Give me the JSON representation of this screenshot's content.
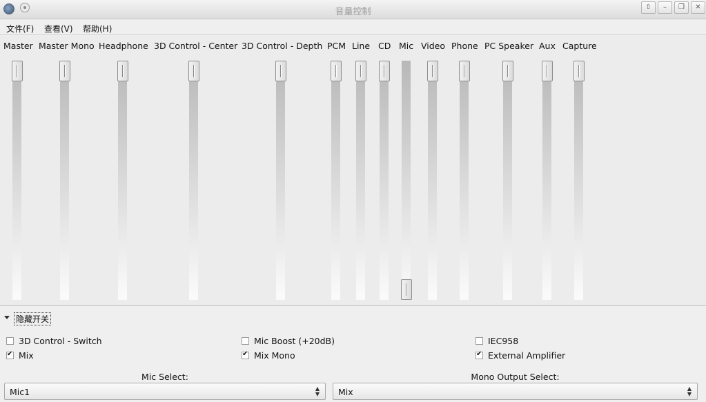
{
  "window": {
    "title": "音量控制",
    "buttons": [
      "⇧",
      "–",
      "❐",
      "✕"
    ]
  },
  "menu": [
    {
      "label": "文件(F)"
    },
    {
      "label": "查看(V)"
    },
    {
      "label": "帮助(H)"
    }
  ],
  "channels": [
    {
      "name": "Master",
      "level": 1.0
    },
    {
      "name": "Master Mono",
      "level": 1.0
    },
    {
      "name": "Headphone",
      "level": 1.0
    },
    {
      "name": "3D Control - Center",
      "level": 1.0
    },
    {
      "name": "3D Control - Depth",
      "level": 1.0
    },
    {
      "name": "PCM",
      "level": 1.0
    },
    {
      "name": "Line",
      "level": 1.0
    },
    {
      "name": "CD",
      "level": 1.0
    },
    {
      "name": "Mic",
      "level": 0.0
    },
    {
      "name": "Video",
      "level": 1.0
    },
    {
      "name": "Phone",
      "level": 1.0
    },
    {
      "name": "PC Speaker",
      "level": 1.0
    },
    {
      "name": "Aux",
      "level": 1.0
    },
    {
      "name": "Capture",
      "level": 1.0
    }
  ],
  "switches": {
    "toggle_label": "隐藏开关",
    "items": [
      {
        "label": "3D Control - Switch",
        "checked": false
      },
      {
        "label": "Mic Boost (+20dB)",
        "checked": false
      },
      {
        "label": "IEC958",
        "checked": false
      },
      {
        "label": "Mix",
        "checked": true
      },
      {
        "label": "Mix Mono",
        "checked": true
      },
      {
        "label": "External Amplifier",
        "checked": true
      }
    ]
  },
  "selects": [
    {
      "label": "Mic Select:",
      "value": "Mic1"
    },
    {
      "label": "Mono Output Select:",
      "value": "Mix"
    }
  ]
}
